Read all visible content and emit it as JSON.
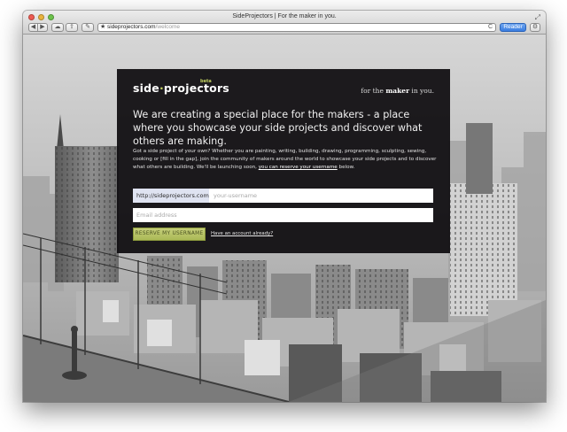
{
  "window": {
    "title": "SideProjectors | For the maker in you.",
    "fullscreen_icon": "fullscreen-icon"
  },
  "toolbar": {
    "back_glyph": "◀",
    "forward_glyph": "▶",
    "cloud_glyph": "☁",
    "share_glyph": "⇪",
    "bookmarks_glyph": "✎",
    "address_host": "sideprojectors.com",
    "address_path": "/welcome",
    "star_glyph": "★",
    "reload_glyph": "C",
    "reader_label": "Reader",
    "settings_glyph": "⚙"
  },
  "page": {
    "logo": {
      "part1": "side",
      "dot": "·",
      "part2": "projectors",
      "beta": "beta"
    },
    "tagline_pre": "for the ",
    "tagline_bold": "maker",
    "tagline_post": " in you.",
    "headline": "We are creating a special place for the makers - a place where you showcase your side projects and discover what others are making.",
    "intro_text": "Got a side project of your own? Whether you are painting, writing, building, drawing, programming, sculpting, sewing, cooking or [fill in the gap], join the community of makers around the world to showcase your side projects and to discover what others are building. We'll be launching soon, ",
    "intro_link": "you can reserve your username",
    "intro_end": " below.",
    "url_prefix": "http://sideprojectors.com/",
    "username_placeholder": "your-username",
    "email_placeholder": "Email address",
    "reserve_button": "RESERVE MY USERNAME",
    "account_link": "Have an account already?"
  },
  "colors": {
    "accent": "#c2d160",
    "panel": "#0e0c0f",
    "reader_blue": "#3a7ee0"
  }
}
